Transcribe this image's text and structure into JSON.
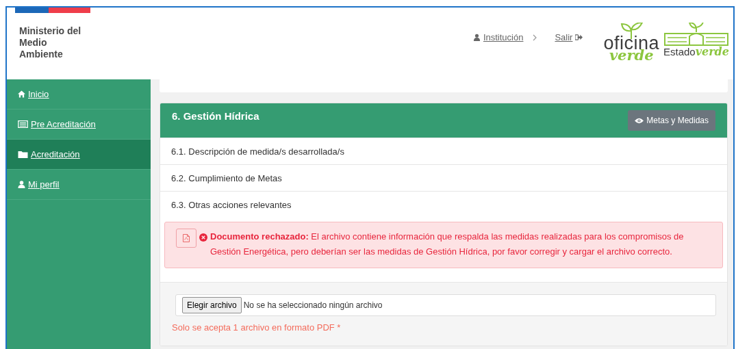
{
  "header": {
    "ministry": [
      "Ministerio del",
      "Medio",
      "Ambiente"
    ],
    "nav": [
      {
        "kind": "user",
        "label": "Institución"
      },
      {
        "kind": "logout",
        "label": "Salir"
      }
    ],
    "logos": [
      {
        "kind": "oficina",
        "top": "oficina",
        "bottom": "verde"
      },
      {
        "kind": "estado",
        "top": "Estado",
        "bottom": "verde"
      }
    ]
  },
  "sidebar": {
    "items": [
      {
        "kind": "home",
        "label": "Inicio",
        "selected": false
      },
      {
        "kind": "list",
        "label": "Pre Acreditación",
        "selected": false
      },
      {
        "kind": "folder",
        "label": "Acreditación",
        "selected": true
      },
      {
        "kind": "user",
        "label": "Mi perfil",
        "selected": false
      }
    ]
  },
  "panel": {
    "title": "6. Gestión Hídrica",
    "button": "Metas y Medidas",
    "items": [
      "6.1. Descripción de medida/s desarrollada/s",
      "6.2. Cumplimiento de Metas",
      "6.3. Otras acciones relevantes"
    ],
    "alert": {
      "text": "**Documento rechazado:** El archivo contiene información que respalda las medidas realizadas para los compromisos de Gestión Energética, pero deberían ser las medidas de Gestión Hídrica, por favor corregir y cargar el archivo correcto."
    },
    "upload": {
      "button": "Elegir archivo",
      "value": "No se ha seleccionado ningún archivo",
      "hint": "Solo se acepta 1 archivo en formato PDF *"
    }
  }
}
